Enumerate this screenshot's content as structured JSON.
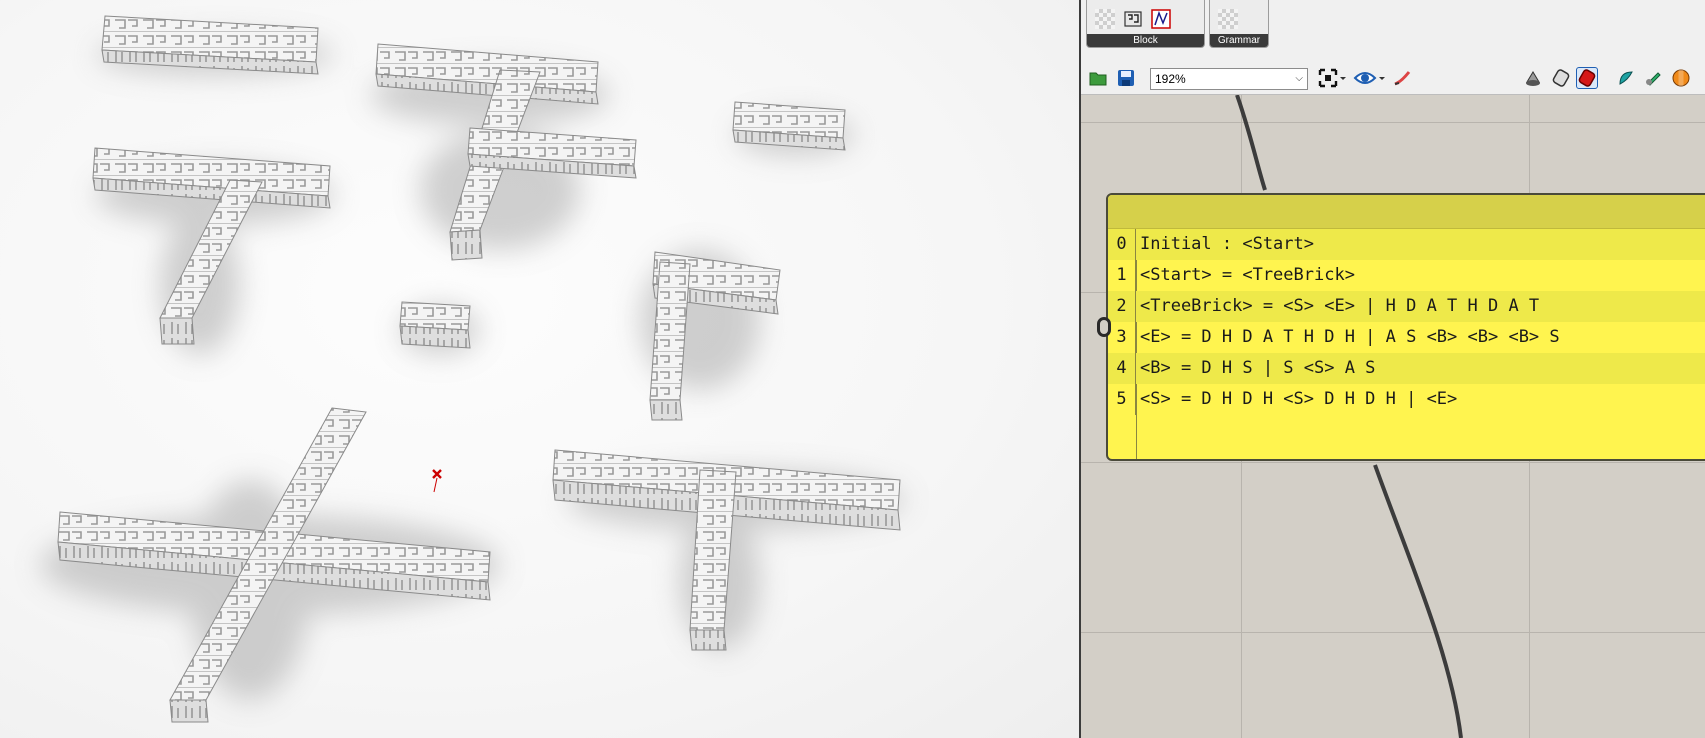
{
  "ribbon": {
    "groups": [
      {
        "label": "Block",
        "icons": [
          "transparency-icon",
          "brick-icon",
          "graph-icon"
        ]
      },
      {
        "label": "Grammar",
        "icons": [
          "transparency-icon"
        ]
      }
    ]
  },
  "toolbar": {
    "zoom_value": "192%",
    "buttons": [
      "open-file-icon",
      "save-file-icon",
      "zoom-extents-icon",
      "preview-eye-icon",
      "sketch-icon",
      "wireframe-preview-icon",
      "shaded-preview-icon",
      "selected-preview-icon",
      "render-color-icon",
      "paint-icon",
      "sphere-icon"
    ]
  },
  "panel": {
    "rows": [
      {
        "index": "0",
        "text": "Initial : <Start>"
      },
      {
        "index": "1",
        "text": "<Start> = <TreeBrick>"
      },
      {
        "index": "2",
        "text": "<TreeBrick> = <S> <E> | H D A T H D A T"
      },
      {
        "index": "3",
        "text": "<E> = D H D A T H D H | A S <B> <B> <B> S"
      },
      {
        "index": "4",
        "text": "<B> = D H S | S <S> A S"
      },
      {
        "index": "5",
        "text": "<S> = D H D H <S> D H D H | <E>"
      }
    ]
  },
  "colors": {
    "panel_bg": "#fff44f",
    "canvas_bg": "#d3cfc7",
    "viewport_bg": "#f6f6f6",
    "marker": "#cc0000"
  }
}
